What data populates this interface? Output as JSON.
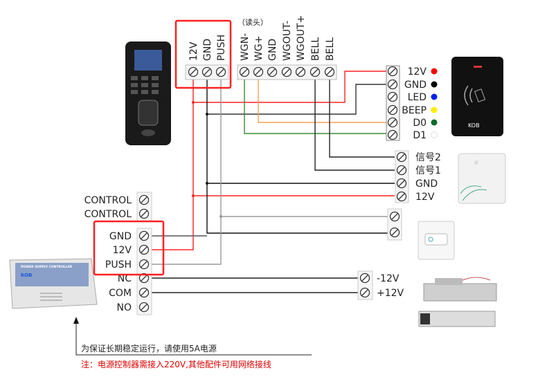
{
  "controller_block": {
    "labels": [
      "12V",
      "GND",
      "PUSH"
    ]
  },
  "reader_header": "（读头）",
  "reader_block": {
    "labels": [
      "WGN-",
      "WG+",
      "GND",
      "WGOUT-",
      "WGOUT+",
      "BELL",
      "BELL"
    ]
  },
  "card_reader": {
    "labels": [
      "12V",
      "GND",
      "LED",
      "BEEP",
      "D0",
      "D1"
    ],
    "dot_colors": [
      "#ff0000",
      "#000000",
      "#0022ee",
      "#ffee00",
      "#0a6a2a",
      "#ffffff"
    ],
    "brand": "KOB"
  },
  "doorbell": {
    "labels": [
      "信号2",
      "信号1",
      "GND",
      "12V"
    ]
  },
  "power_block": {
    "control_labels": [
      "CONTROL",
      "CONTROL"
    ],
    "labels": [
      "GND",
      "12V",
      "PUSH",
      "NC",
      "COM",
      "NO"
    ],
    "brand": "KOB",
    "device_title": "POWER SUPPLY CONTROLLER"
  },
  "lock_block": {
    "labels": [
      "-12V",
      "+12V"
    ]
  },
  "notes": {
    "tip": "为保证长期稳定运行，请使用5A电源",
    "warning": "注：电源控制器需接入220V,其他配件可用网络接线"
  },
  "colors": {
    "highlight": "#ff2020",
    "red_wire": "#ff2020",
    "black_wire": "#111111",
    "gray_wire": "#9a9a9a",
    "orange_wire": "#f5a050",
    "green_wire": "#3a8a3a",
    "warning_text": "#e00000"
  }
}
